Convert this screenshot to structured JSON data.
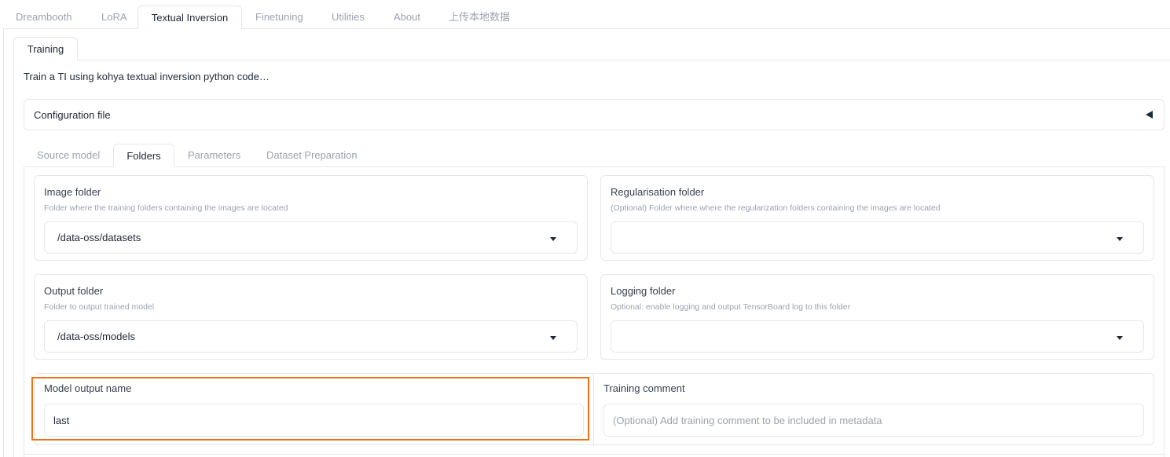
{
  "top_tabs": [
    {
      "label": "Dreambooth"
    },
    {
      "label": "LoRA"
    },
    {
      "label": "Textual Inversion"
    },
    {
      "label": "Finetuning"
    },
    {
      "label": "Utilities"
    },
    {
      "label": "About"
    },
    {
      "label": "上传本地数据"
    }
  ],
  "active_top_tab": "Textual Inversion",
  "training_tab": {
    "label": "Training"
  },
  "description": "Train a TI using kohya textual inversion python code…",
  "config": {
    "label": "Configuration file",
    "icon": "collapse-arrow-icon"
  },
  "inner_tabs": [
    {
      "label": "Source model"
    },
    {
      "label": "Folders"
    },
    {
      "label": "Parameters"
    },
    {
      "label": "Dataset Preparation"
    }
  ],
  "active_inner_tab": "Folders",
  "folders": {
    "image": {
      "title": "Image folder",
      "info": "Folder where the training folders containing the images are located",
      "value": "/data-oss/datasets"
    },
    "reg": {
      "title": "Regularisation folder",
      "info": "(Optional) Folder where where the regularization folders containing the images are located",
      "value": ""
    },
    "output": {
      "title": "Output folder",
      "info": "Folder to output trained model",
      "value": "/data-oss/models"
    },
    "logging": {
      "title": "Logging folder",
      "info": "Optional: enable logging and output TensorBoard log to this folder",
      "value": ""
    }
  },
  "model_output": {
    "title": "Model output name",
    "value": "last"
  },
  "training_comment": {
    "title": "Training comment",
    "placeholder": "(Optional) Add training comment to be included in metadata"
  },
  "colors": {
    "highlight": "#f07114",
    "border": "#e5e7eb",
    "muted": "#9ca3af"
  }
}
